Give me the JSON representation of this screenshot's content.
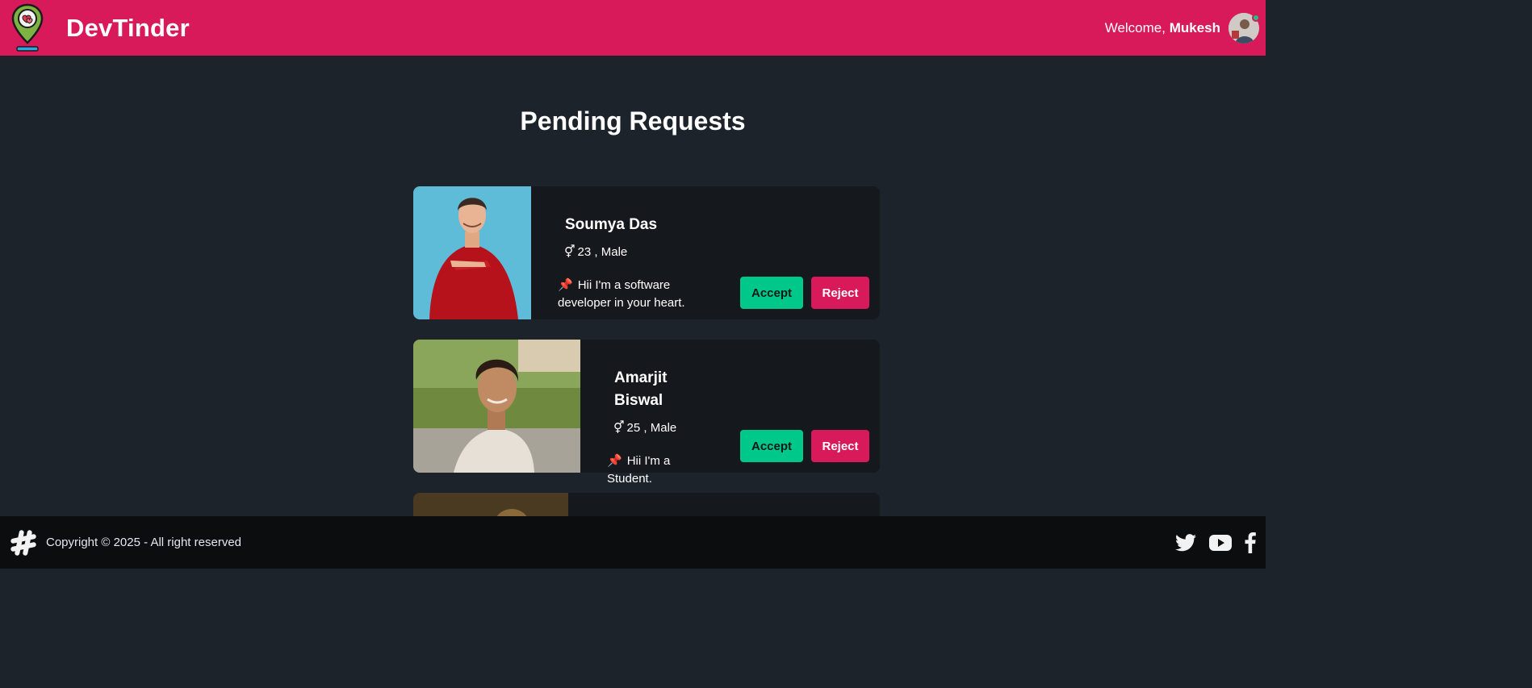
{
  "navbar": {
    "brand": "DevTinder",
    "welcome_prefix": "Welcome, ",
    "username": "Mukesh",
    "logo_icon": "location-heart-icon",
    "brand_color": "#d8195a"
  },
  "page": {
    "title": "Pending Requests"
  },
  "requests": [
    {
      "name": "Soumya Das",
      "age_gender": "23 , Male",
      "bio": "Hii I'm a software developer in your heart.",
      "accept_label": "Accept",
      "reject_label": "Reject"
    },
    {
      "name": "Amarjit Biswal",
      "age_gender": "25 , Male",
      "bio": "Hii I'm a Student.",
      "accept_label": "Accept",
      "reject_label": "Reject"
    }
  ],
  "footer": {
    "copyright": "Copyright © 2025 - All right reserved",
    "icons": [
      "hashtag-icon",
      "twitter-icon",
      "youtube-icon",
      "facebook-icon"
    ]
  },
  "colors": {
    "accent": "#d8195a",
    "accept": "#00c78a",
    "background": "#1d232a",
    "card": "#15191e"
  }
}
